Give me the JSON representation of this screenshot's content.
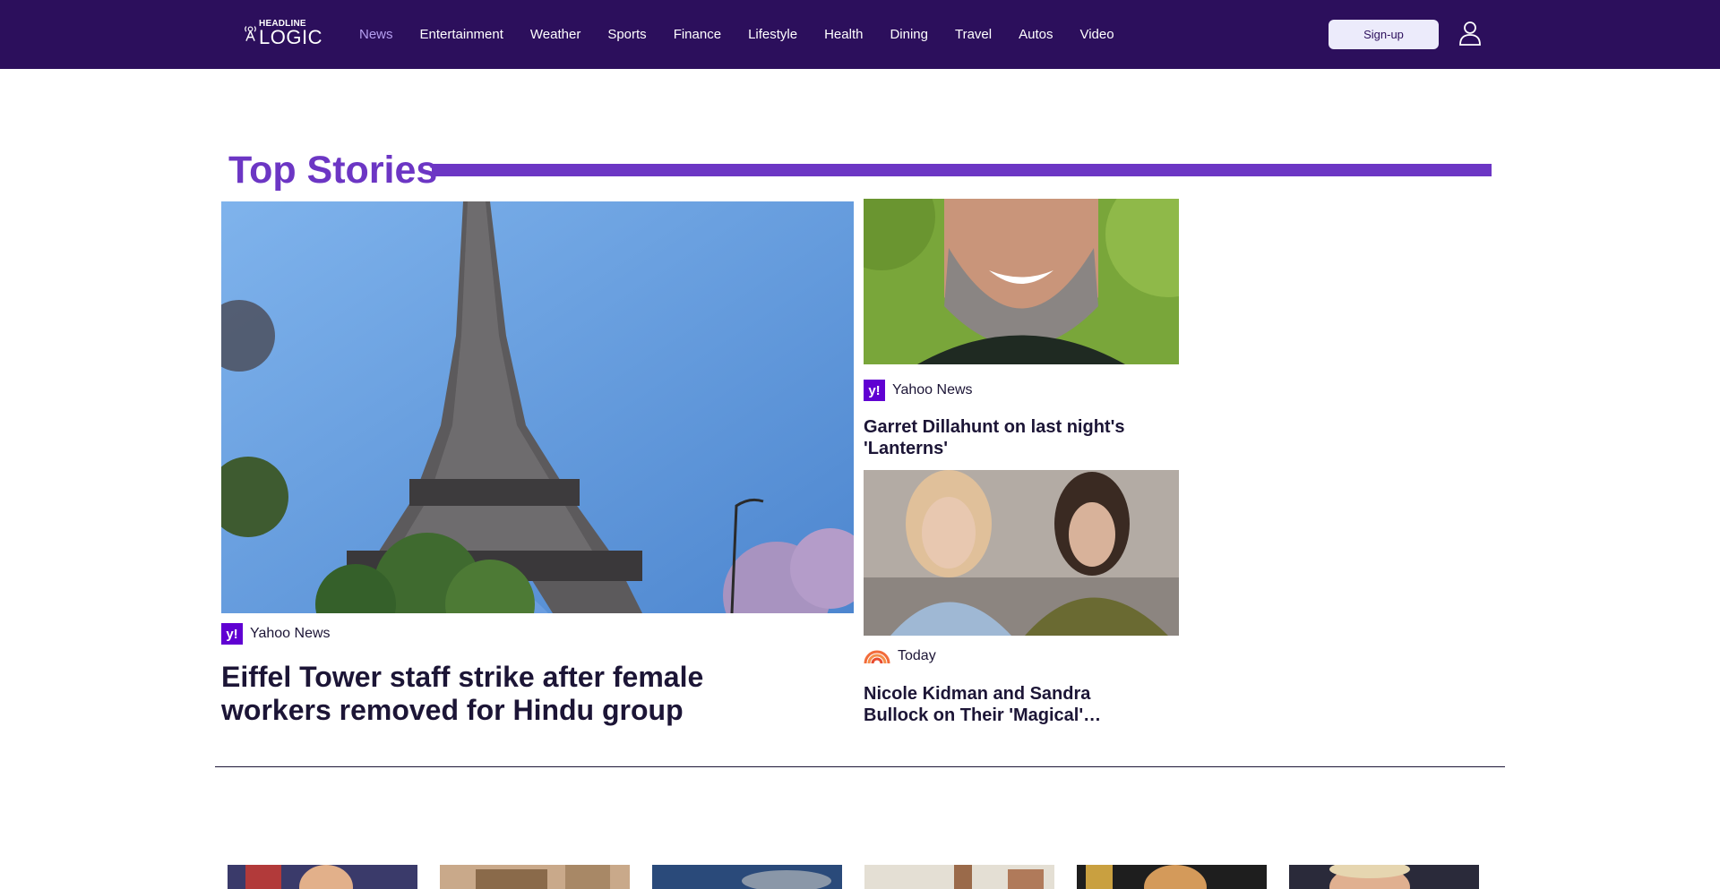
{
  "header": {
    "logo": {
      "line1": "HEADLINE",
      "line2": "LOGIC",
      "icon": "headline-logic-logo"
    },
    "nav": [
      {
        "label": "News",
        "active": true
      },
      {
        "label": "Entertainment"
      },
      {
        "label": "Weather"
      },
      {
        "label": "Sports"
      },
      {
        "label": "Finance"
      },
      {
        "label": "Lifestyle"
      },
      {
        "label": "Health"
      },
      {
        "label": "Dining"
      },
      {
        "label": "Travel"
      },
      {
        "label": "Autos"
      },
      {
        "label": "Video"
      }
    ],
    "signup_label": "Sign-up",
    "user_icon": "user-icon"
  },
  "section": {
    "title": "Top Stories"
  },
  "hero": {
    "source": "Yahoo News",
    "source_logo": "y!",
    "title": "Eiffel Tower staff strike after female workers removed for Hindu group"
  },
  "cards": [
    {
      "source": "Yahoo News",
      "source_logo": "y!",
      "title": "Garret Dillahunt on last night's 'Lanterns'"
    },
    {
      "source": "Today",
      "source_logo": "today-rainbow-logo",
      "title": "Nicole Kidman and Sandra Bullock on Their 'Magical' Reunion"
    }
  ],
  "colors": {
    "header_bg": "#2c0f5c",
    "accent": "#6c36c4",
    "active_nav": "#b59ff0",
    "yahoo_purple": "#6001d2"
  }
}
